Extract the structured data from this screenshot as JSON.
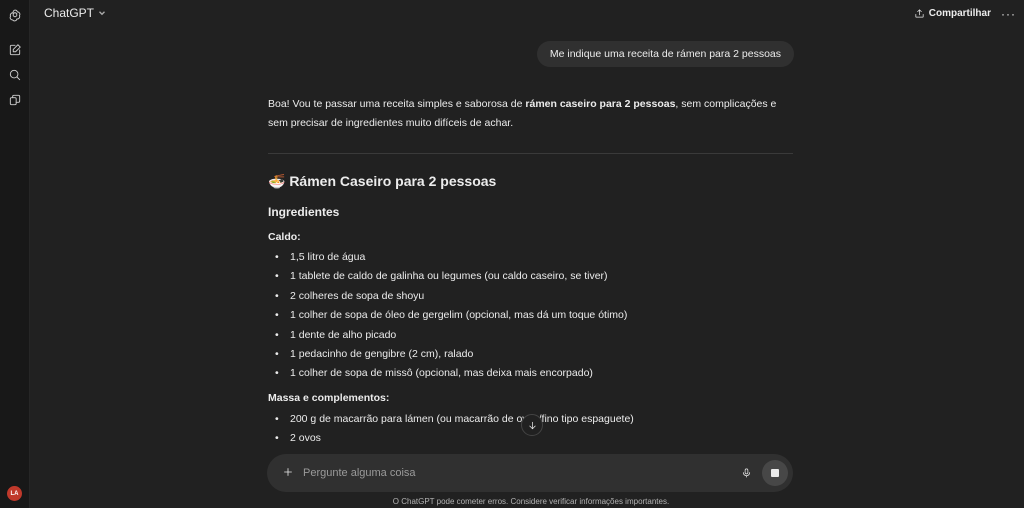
{
  "sidebar": {
    "avatar_initials": "LA",
    "icons": [
      "openai-logo-icon",
      "new-chat-icon",
      "search-icon",
      "library-icon"
    ]
  },
  "header": {
    "model_label": "ChatGPT",
    "share_label": "Compartilhar",
    "more_label": "···"
  },
  "user_message": "Me indique uma receita de rámen para 2 pessoas",
  "assistant": {
    "intro_part1": "Boa! Vou te passar uma receita simples e saborosa de ",
    "intro_bold": "rámen caseiro para 2 pessoas",
    "intro_part2": ", sem complicações e sem precisar de ingredientes muito difíceis de achar.",
    "recipe_title": "🍜 Rámen Caseiro para 2 pessoas",
    "ingredients_heading": "Ingredientes",
    "broth_label": "Caldo:",
    "broth_items": [
      "1,5 litro de água",
      "1 tablete de caldo de galinha ou legumes (ou caldo caseiro, se tiver)",
      "2 colheres de sopa de shoyu",
      "1 colher de sopa de óleo de gergelim (opcional, mas dá um toque ótimo)",
      "1 dente de alho picado",
      "1 pedacinho de gengibre (2 cm), ralado",
      "1 colher de sopa de missô (opcional, mas deixa mais encorpado)"
    ],
    "noodles_label": "Massa e complementos:",
    "noodles_items": [
      "200 g de macarrão para lámen (ou macarrão de ovos/fino tipo espaguete)",
      "2 ovos"
    ]
  },
  "composer": {
    "placeholder": "Pergunte alguma coisa"
  },
  "disclaimer": "O ChatGPT pode cometer erros. Considere verificar informações importantes.",
  "colors": {
    "background": "#212121",
    "sidebar": "#181818",
    "bubble": "#303030",
    "avatar": "#c0392b"
  }
}
